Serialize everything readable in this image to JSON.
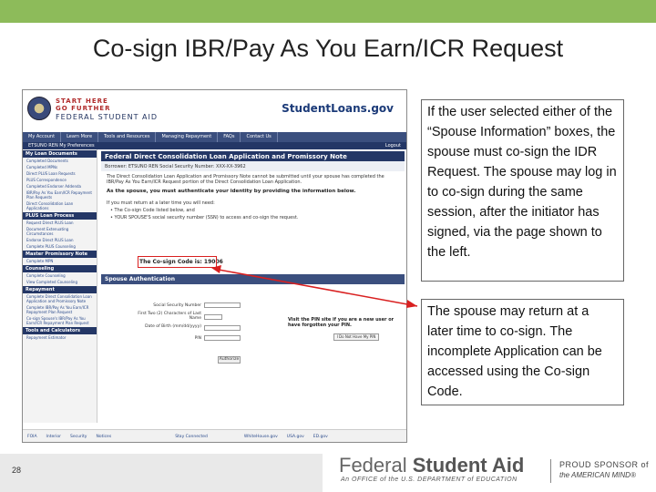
{
  "slide": {
    "title": "Co-sign IBR/Pay As You Earn/ICR Request",
    "page_number": "28",
    "accent_color": "#8dbb5a"
  },
  "screenshot": {
    "logo_line1": "START HERE",
    "logo_line2": "GO FURTHER",
    "logo_line3": "FEDERAL STUDENT AID",
    "site_logo": "StudentLoans.gov",
    "nav": [
      "My Account",
      "Learn More",
      "Tools and Resources",
      "Managing Repayment",
      "FAQs",
      "Contact Us"
    ],
    "nav2_left": "ETSUNO REN   My Preferences",
    "nav2_right": "Logout",
    "sidebar": [
      {
        "head": "My Loan Documents",
        "items": [
          "Completed Documents",
          "Completed MPNs",
          "Direct PLUS Loan Requests",
          "PLUS Correspondence",
          "Completed Endorser Addenda",
          "IBR/Pay As You Earn/ICR Repayment Plan Requests",
          "Direct Consolidation Loan Applications"
        ]
      },
      {
        "head": "PLUS Loan Process",
        "items": [
          "Request Direct PLUS Loan",
          "Document Extenuating Circumstances",
          "Endorse Direct PLUS Loan",
          "Complete PLUS Counseling"
        ]
      },
      {
        "head": "Master Promissory Note",
        "items": [
          "Complete MPN"
        ]
      },
      {
        "head": "Counseling",
        "items": [
          "Complete Counseling",
          "View Completed Counseling"
        ]
      },
      {
        "head": "Repayment",
        "items": [
          "Complete Direct Consolidation Loan Application and Promissory Note",
          "Complete IBR/Pay As You Earn/ICR Repayment Plan Request",
          "Co-sign Spouse's IBR/Pay As You Earn/ICR Repayment Plan Request"
        ]
      },
      {
        "head": "Tools and Calculators",
        "items": [
          "Repayment Estimator"
        ]
      }
    ],
    "main_title": "Federal Direct Consolidation Loan Application and Promissory Note",
    "borrower": "Borrower: ETSUNO REN     Social Security Number: XXX-XX-3962",
    "notice": "The Direct Consolidation Loan Application and Promissory Note cannot be submitted until your spouse has completed the IBR/Pay As You Earn/ICR Request portion of the Direct Consolidation Loan Application.",
    "bold_line": "As the spouse, you must authenticate your identity by providing the information below.",
    "auth": "If you must return at a later time you will need:",
    "bullets": [
      "The Co-sign Code listed below, and",
      "YOUR SPOUSE'S social security number (SSN) to access and co-sign the request."
    ],
    "cosign_code": "The Co-sign Code is: 19006",
    "spouse_auth": "Spouse Authentication",
    "form_labels": [
      "Social Security Number",
      "First Two (2) Characters of Last Name",
      "Date of Birth (mm/dd/yyyy)",
      "PIN"
    ],
    "pin_note": "Visit the PIN site if you are a new user or have forgotten your PIN.",
    "pin_button": "I Do Not Have My PIN",
    "submit": "Authorize",
    "footer": [
      "FOIA",
      "Interior",
      "Security",
      "Notices",
      "Stay Connected",
      "WhiteHouse.gov",
      "USA.gov",
      "ED.gov"
    ]
  },
  "notes": {
    "first": "If the user selected either of the “Spouse Information” boxes, the spouse must co-sign the IDR Request.  The spouse may log in to co-sign during the same session, after the initiator has signed, via the page shown to the left.",
    "second": "The spouse may return at a later time to co-sign. The incomplete Application can be accessed using the Co-sign Code."
  },
  "brand": {
    "fsa_part1": "Federal",
    "fsa_part2": "Student Aid",
    "fsa_sub": "An OFFICE of the U.S. DEPARTMENT of EDUCATION",
    "proud1": "PROUD SPONSOR of",
    "proud2": "the AMERICAN MIND®"
  }
}
